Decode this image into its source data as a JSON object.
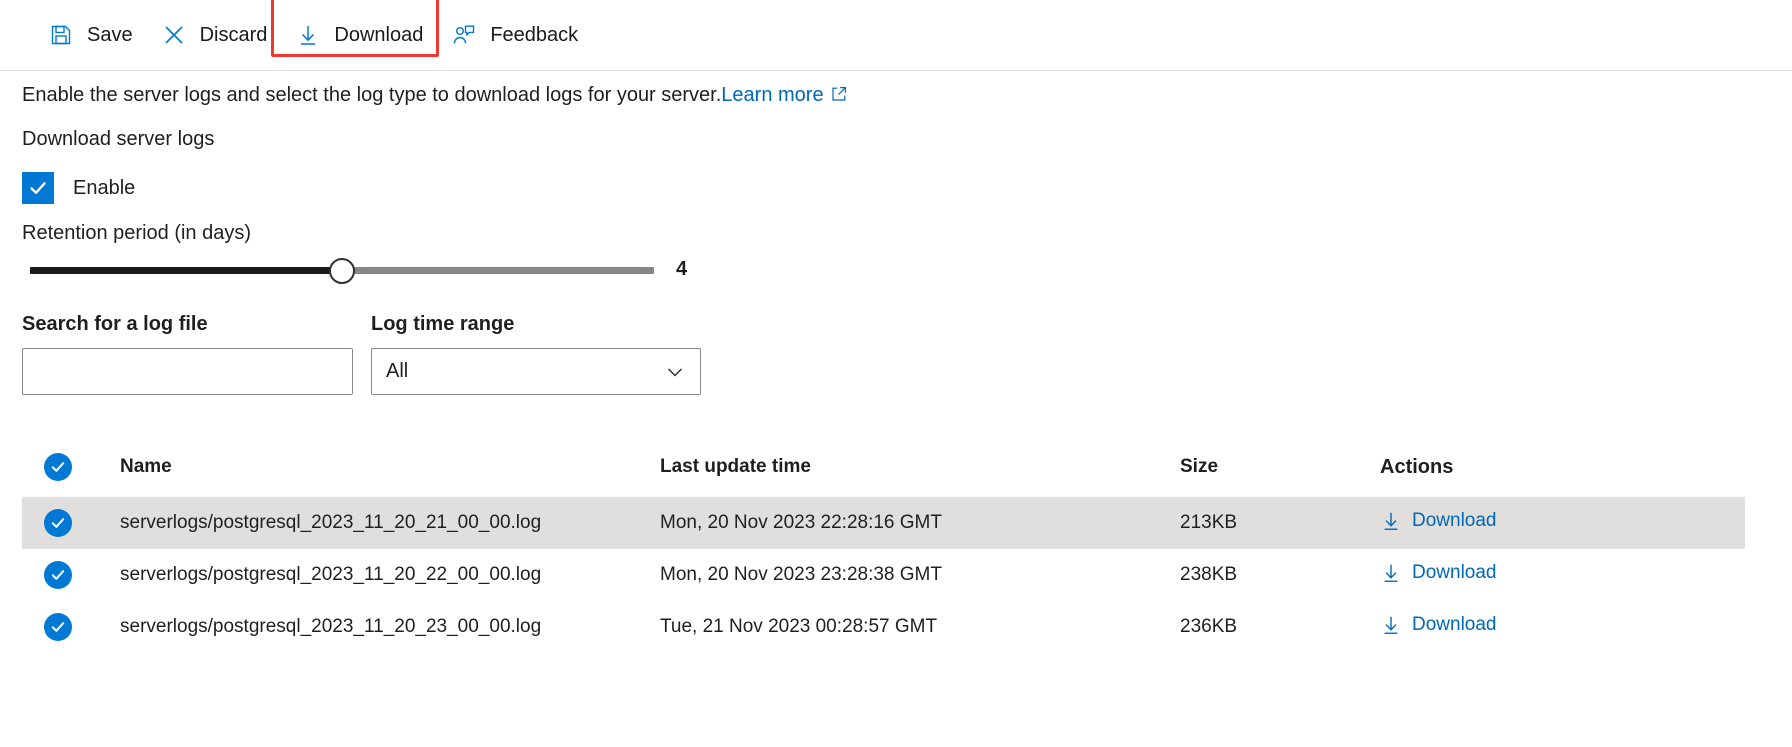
{
  "toolbar": {
    "items": [
      {
        "label": "Save",
        "icon": "save-icon"
      },
      {
        "label": "Discard",
        "icon": "discard-icon"
      },
      {
        "label": "Download",
        "icon": "download-icon"
      },
      {
        "label": "Feedback",
        "icon": "feedback-icon"
      }
    ],
    "highlight_color": "#f0372f",
    "icon_color": "#0078d4"
  },
  "description": {
    "text": "Enable the server logs and select the log type to download logs for your server.",
    "link_label": "Learn more",
    "link_icon": "external-link-icon",
    "link_color": "#0067b8"
  },
  "section": {
    "title": "Download server logs"
  },
  "enable_checkbox": {
    "label": "Enable",
    "checked": true,
    "color": "#0078d4"
  },
  "retention_slider": {
    "label": "Retention period (in days)",
    "value": "4",
    "fill_percent": 50,
    "fill_color": "#1b1a19",
    "track_color": "#8a8886"
  },
  "search_field": {
    "label": "Search for a log file",
    "value": "",
    "placeholder": ""
  },
  "time_range_field": {
    "label": "Log time range",
    "value": "All",
    "icon": "chevron-down-icon"
  },
  "table": {
    "columns": [
      "Name",
      "Last update time",
      "Size",
      "Actions"
    ],
    "select_all_checked": true,
    "action_label": "Download",
    "action_icon": "download-icon",
    "rows": [
      {
        "checked": true,
        "name": "serverlogs/postgresql_2023_11_20_21_00_00.log",
        "updated": "Mon, 20 Nov 2023 22:28:16 GMT",
        "size": "213KB",
        "action": "Download",
        "highlighted": true
      },
      {
        "checked": true,
        "name": "serverlogs/postgresql_2023_11_20_22_00_00.log",
        "updated": "Mon, 20 Nov 2023 23:28:38 GMT",
        "size": "238KB",
        "action": "Download",
        "highlighted": false
      },
      {
        "checked": true,
        "name": "serverlogs/postgresql_2023_11_20_23_00_00.log",
        "updated": "Tue, 21 Nov 2023 00:28:57 GMT",
        "size": "236KB",
        "action": "Download",
        "highlighted": false
      }
    ]
  }
}
